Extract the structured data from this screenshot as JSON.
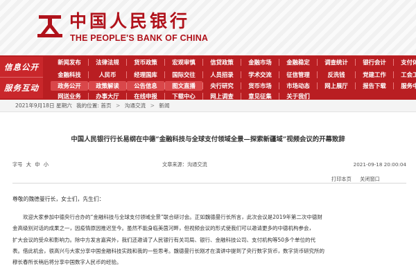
{
  "header": {
    "bank_name_cn": "中国人民银行",
    "bank_name_en": "THE PEOPLE'S BANK OF CHINA",
    "colors": {
      "brand_red": "#b0121b",
      "nav_red": "#b91e22"
    }
  },
  "nav": {
    "side_labels": [
      "信息公开",
      "服务互动"
    ],
    "rows": [
      [
        "新闻发布",
        "法律法规",
        "货币政策",
        "宏观审慎",
        "信贷政策",
        "金融市场",
        "金融稳定",
        "调查统计",
        "银行会计",
        "支付体系"
      ],
      [
        "金融科技",
        "人民币",
        "经理国库",
        "国际交往",
        "人员招录",
        "学术交流",
        "征信管理",
        "反洗钱",
        "党建工作",
        "工会工作"
      ],
      [
        "政务公开",
        "政策解读",
        "公告信息",
        "图文直播",
        "央行研究",
        "货币市场",
        "市场动态",
        "网上展厅",
        "报告下载",
        "服务中心"
      ],
      [
        "网送业务",
        "办事大厅",
        "在线申报",
        "下载中心",
        "网上调查",
        "意见征集",
        "关于我们",
        "",
        "",
        ""
      ]
    ]
  },
  "breadcrumb": {
    "date": "2021年9月18日 星期六",
    "location_prefix": "我的位置:",
    "items": [
      "首页",
      "沟通交流",
      "新闻"
    ],
    "separator": ">"
  },
  "article": {
    "title": "中国人民银行行长易纲在中德“金融科技与全球支付领域全景—探索新疆域”视频会议的开幕致辞",
    "font_size_label": "字号",
    "font_options": [
      "大",
      "中",
      "小"
    ],
    "source": "文章来源：沟通交流",
    "date": "2021-09-18 20:00:04",
    "tools": [
      "打印本页",
      "关闭窗口"
    ],
    "salutation": "尊敬的魏德曼行长，女士们，先生们：",
    "body_lines": [
      "欢迎大家参加中德央行合办的“金融科技与全球支付领域全景”联合研讨会。正如魏德曼行长所言，此次会议是2019年第二次中德财",
      "金高级别对话的成果之一，因疫情原因推迟至今。虽然不能身临美茵河畔，但视频会议的形式使我们可以邀请更多的中德机构参会，",
      "扩大会议的受众和影响力。除中方发言嘉宾外，我们还邀请了人民银行有关司局、银行、金融科技公司、支付机构等50多个单位的代",
      "表。借此机会，很高兴与大家分享中国金融科技实践和我的一些思考。魏德曼行长刚才在演讲中提到了央行数字货币，数字货币研究所的",
      "穆长春所长稍后将分享中国数字人民币的经验。"
    ]
  }
}
